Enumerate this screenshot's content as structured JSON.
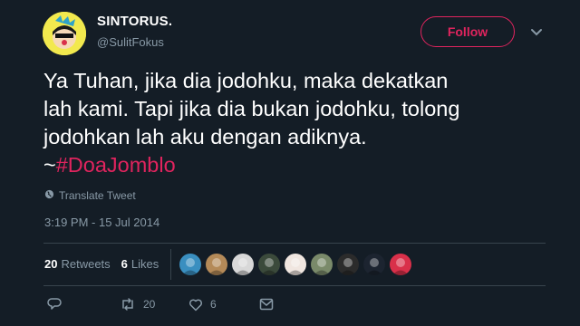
{
  "header": {
    "display_name": "SINTORUS.",
    "handle": "@SulitFokus",
    "follow_label": "Follow"
  },
  "tweet": {
    "lines": [
      "Ya Tuhan, jika dia jodohku, maka dekatkan",
      "lah kami. Tapi jika dia bukan jodohku, tolong",
      "jodohkan lah aku dengan adiknya."
    ],
    "hashtag_prefix": "~",
    "hashtag": "#DoaJomblo"
  },
  "translate_label": "Translate Tweet",
  "timestamp": "3:19 PM - 15 Jul 2014",
  "stats": {
    "retweets_count": "20",
    "retweets_label": "Retweets",
    "likes_count": "6",
    "likes_label": "Likes"
  },
  "likers": [
    {
      "color": "#3a8fc0"
    },
    {
      "color": "#b48a58"
    },
    {
      "color": "#d8d8d8"
    },
    {
      "color": "#3b4a3b"
    },
    {
      "color": "#f0e6e0"
    },
    {
      "color": "#7a8a6a"
    },
    {
      "color": "#2b2b2b"
    },
    {
      "color": "#1c2430"
    },
    {
      "color": "#d9304a"
    }
  ],
  "actions": {
    "retweet_count": "20",
    "like_count": "6"
  },
  "colors": {
    "background": "#141d26",
    "accent": "#e0245e",
    "muted": "#8899a6",
    "divider": "#38444d"
  }
}
